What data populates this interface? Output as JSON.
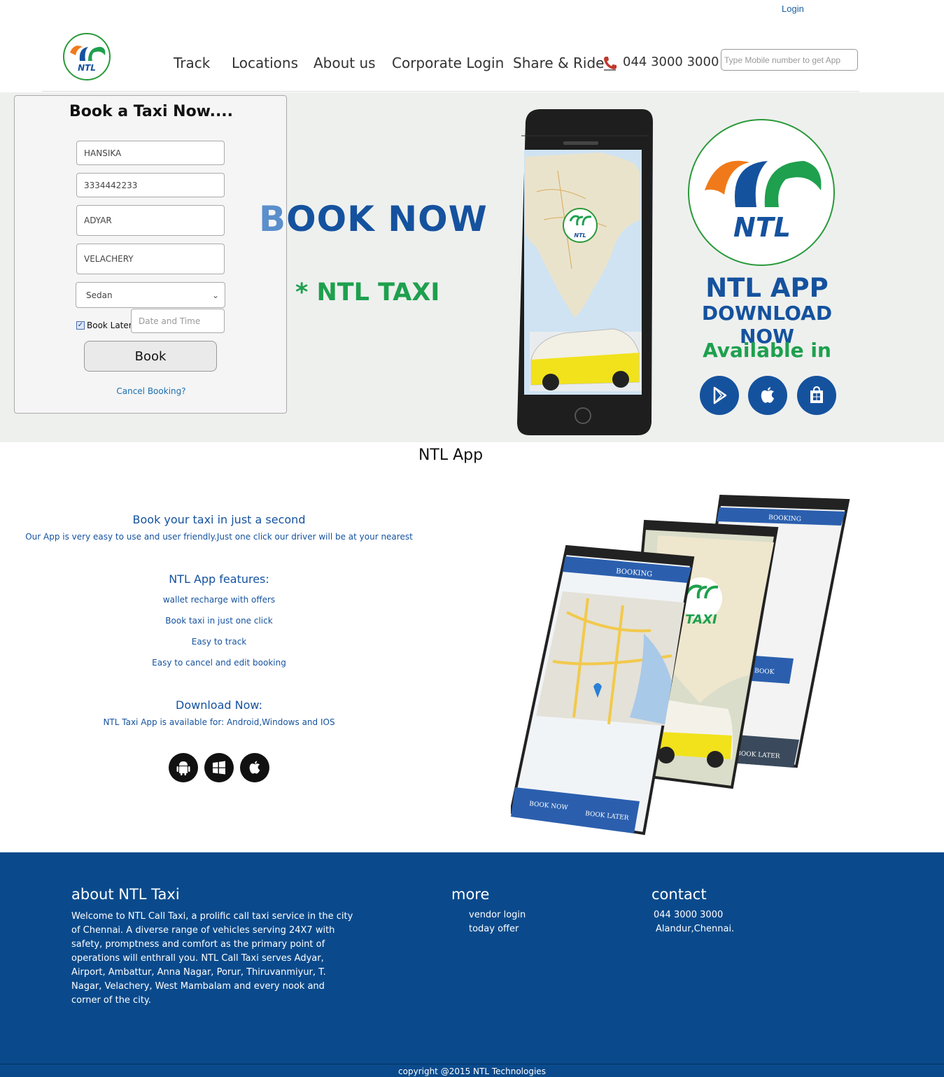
{
  "header": {
    "login_label": "Login",
    "logo_text": "NTL",
    "nav": [
      "Track",
      "Locations",
      "About us",
      "Corporate Login",
      "Share & Ride"
    ],
    "phone": "044 3000 3000",
    "app_input_placeholder": "Type Mobile number to get App"
  },
  "booking_form": {
    "title": "Book a Taxi Now....",
    "name_value": "HANSIKA",
    "mobile_value": "3334442233",
    "pickup_value": "ADYAR",
    "drop_value": "VELACHERY",
    "vehicle_selected": "Sedan",
    "book_later_label": "Book Later",
    "book_later_checked": true,
    "date_placeholder": "Date and Time",
    "book_button": "Book",
    "cancel_link": "Cancel Booking?"
  },
  "hero": {
    "book_now_first": "B",
    "book_now_rest": "OOK NOW",
    "ntl_taxi": "* NTL TAXI",
    "app_line1": "NTL APP",
    "app_line2": "DOWNLOAD NOW",
    "available": "Available in",
    "logo_text": "NTL",
    "store_icons": [
      "play-store-icon",
      "apple-icon",
      "windows-store-icon"
    ]
  },
  "app_section": {
    "title": "NTL App",
    "heading1": "Book your taxi in just a second",
    "line1": "Our App is very easy to use and user friendly.Just one click our driver will be at your nearest",
    "heading2": "NTL App features:",
    "features": [
      "wallet recharge with offers",
      "Book taxi in just one click",
      "Easy to track",
      "Easy to cancel and edit booking"
    ],
    "heading3": "Download Now:",
    "line3": "NTL Taxi App is available for: Android,Windows and IOS",
    "os_icons": [
      "android-icon",
      "windows-icon",
      "apple-icon"
    ],
    "screen_labels": {
      "booking": "BOOKING",
      "book_now": "BOOK NOW",
      "book_later": "BOOK LATER",
      "book": "BOOK",
      "taxi": "TAXI"
    }
  },
  "footer": {
    "about_title": "about NTL Taxi",
    "about_text": "Welcome to NTL Call Taxi, a prolific call taxi service in the city of Chennai. A diverse range of vehicles serving 24X7 with safety, promptness and comfort as the primary point of operations will enthrall you. NTL Call Taxi serves Adyar, Airport, Ambattur, Anna Nagar, Porur, Thiruvanmiyur, T. Nagar, Velachery, West Mambalam and every nook and corner of the city.",
    "more_title": "more",
    "more_links": [
      "vendor login",
      "today offer"
    ],
    "contact_title": "contact",
    "contact_phone": "044 3000 3000",
    "contact_address": "Alandur,Chennai.",
    "copyright": "copyright @2015 NTL Technologies"
  },
  "colors": {
    "brand_blue": "#15529e",
    "brand_green": "#1ea04e",
    "brand_orange": "#f07a1a",
    "footer_bg": "#0a4a8c",
    "hero_bg": "#eef0ee"
  }
}
